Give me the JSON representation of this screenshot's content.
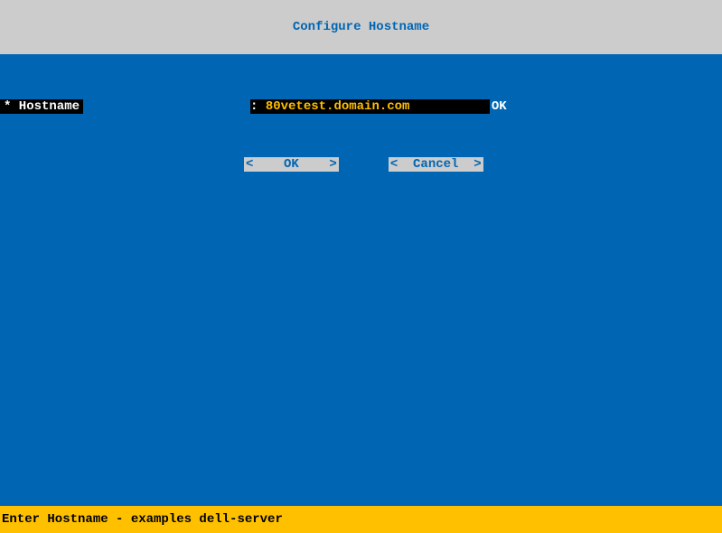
{
  "title": "Configure Hostname",
  "field": {
    "label": "* Hostname",
    "prefix": ": ",
    "value": "80vetest.domain.com",
    "suffix": "OK"
  },
  "buttons": {
    "ok": "<    OK    >",
    "cancel": "<  Cancel  >"
  },
  "status": "Enter Hostname - examples dell-server"
}
